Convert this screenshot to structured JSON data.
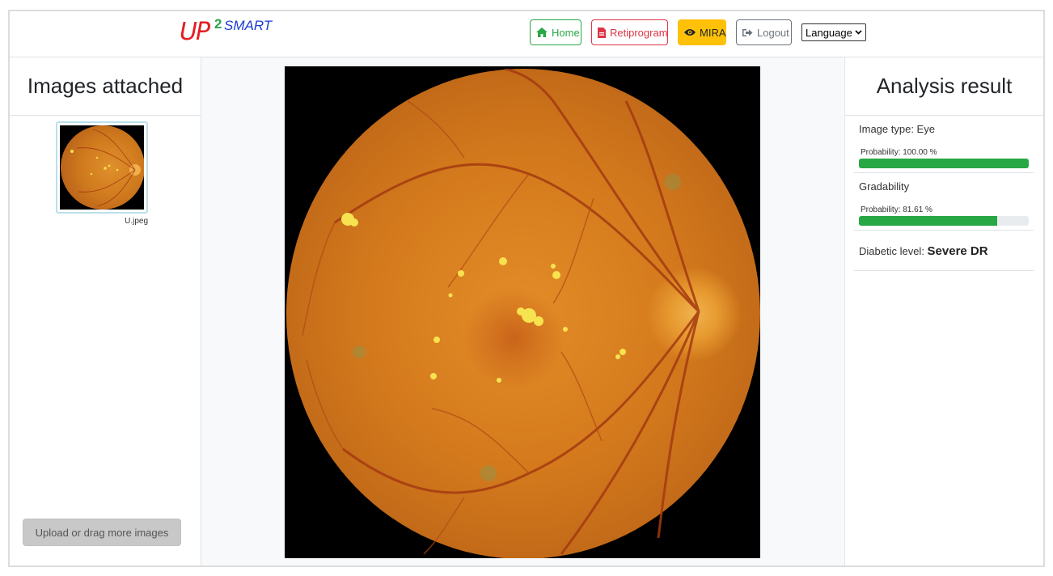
{
  "header": {
    "logo": {
      "up": "UP",
      "two": "2",
      "smart": "SMART"
    },
    "nav": {
      "home": "Home",
      "retiprogram": "Retiprogram",
      "mira": "MIRA",
      "logout": "Logout",
      "language": "Language"
    }
  },
  "left_panel": {
    "title": "Images attached",
    "files": [
      {
        "name": "U.jpeg"
      }
    ],
    "upload_label": "Upload or drag more images"
  },
  "right_panel": {
    "title": "Analysis result",
    "image_type": {
      "label": "Image type: ",
      "value": "Eye",
      "probability_text": "Probability: 100.00 %",
      "probability": 100.0
    },
    "gradability": {
      "label": "Gradability",
      "probability_text": "Probability: 81.61 %",
      "probability": 81.61
    },
    "diabetic": {
      "label": "Diabetic level: ",
      "value": "Severe DR"
    }
  },
  "colors": {
    "success": "#28a745",
    "danger": "#dc3545",
    "warning": "#ffc107",
    "secondary": "#6c757d"
  },
  "icons": {
    "home": "home-icon",
    "retiprogram": "file-pdf-icon",
    "mira": "eye-icon",
    "logout": "sign-out-icon",
    "language": "chevron-down-icon"
  }
}
